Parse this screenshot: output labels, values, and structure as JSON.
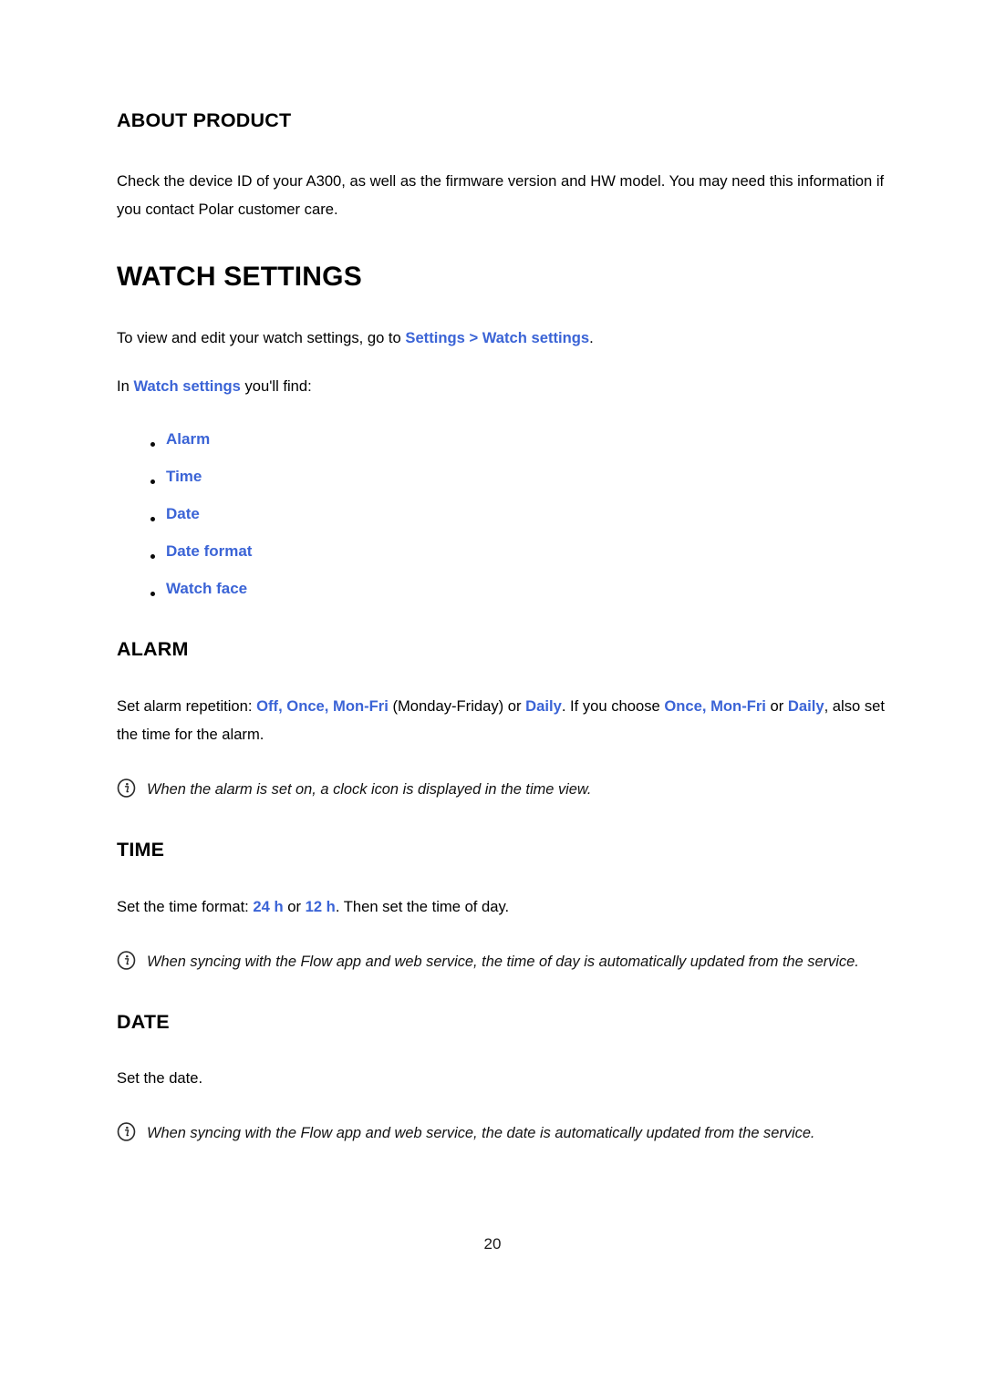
{
  "document": {
    "page_number": "20",
    "link_color": "#3b64d6",
    "text_color": "#000000"
  },
  "about_product": {
    "heading": "ABOUT PRODUCT",
    "paragraph": "Check the device ID of your A300, as well as the firmware version and HW model. You may need this information if you contact Polar customer care."
  },
  "watch_settings": {
    "heading": "WATCH SETTINGS",
    "intro": {
      "prefix": "To view and edit your watch settings, go to ",
      "link": "Settings > Watch settings",
      "suffix": "."
    },
    "find_line": {
      "prefix": "In ",
      "link": "Watch settings",
      "suffix": " you'll find:"
    },
    "items": [
      {
        "label": "Alarm"
      },
      {
        "label": "Time"
      },
      {
        "label": "Date"
      },
      {
        "label": "Date format"
      },
      {
        "label": "Watch face"
      }
    ]
  },
  "alarm": {
    "heading": "ALARM",
    "paragraph": {
      "p1": "Set alarm repetition: ",
      "l1": "Off, Once, Mon-Fri",
      "p2": " (Monday-Friday) or ",
      "l2": "Daily",
      "p3": ". If you choose ",
      "l3": "Once, Mon-Fri",
      "p4": " or ",
      "l4": "Daily",
      "p5": ", also set the time for the alarm."
    },
    "note": "When the alarm is set on, a clock icon is displayed in the time view."
  },
  "time": {
    "heading": "TIME",
    "paragraph": {
      "p1": "Set the time format: ",
      "l1": "24 h",
      "p2": " or ",
      "l2": "12 h",
      "p3": ". Then set the time of day."
    },
    "note": "When syncing with the Flow app and web service, the time of day is automatically updated from the service."
  },
  "date": {
    "heading": "DATE",
    "paragraph": "Set the date.",
    "note": "When syncing with the Flow app and web service, the date is automatically updated from the service."
  },
  "icons": {
    "info": "info-circle-icon"
  }
}
